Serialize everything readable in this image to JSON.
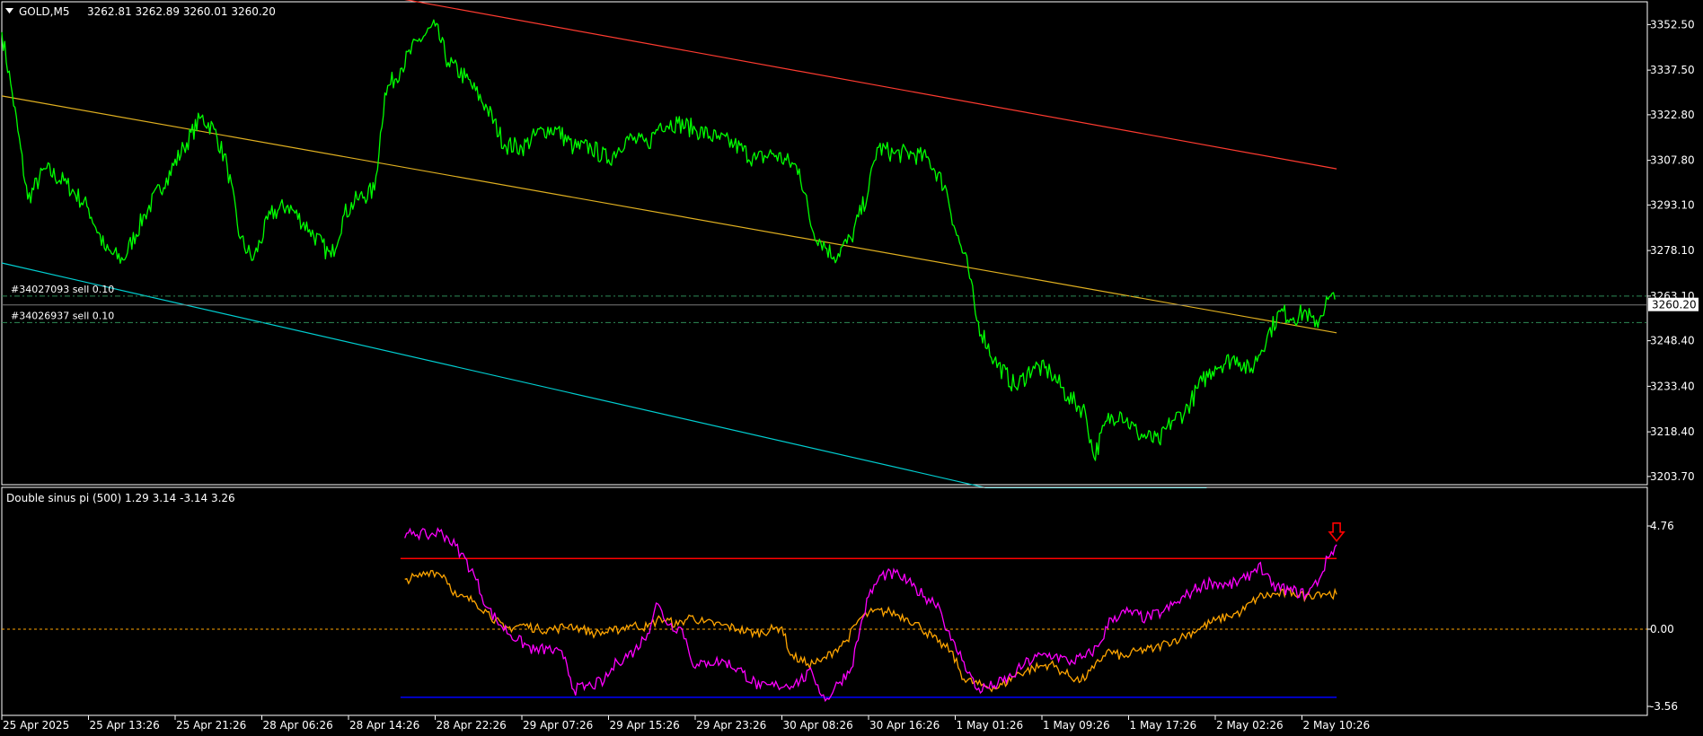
{
  "header": {
    "symbol_title": "GOLD,M5",
    "ohlc": "3262.81 3262.89 3260.01 3260.20"
  },
  "price_axis": {
    "ticks": [
      "3352.50",
      "3337.50",
      "3322.80",
      "3307.80",
      "3293.10",
      "3278.10",
      "3263.10",
      "3248.40",
      "3233.40",
      "3218.40",
      "3203.70"
    ],
    "current_price_label": "3260.20"
  },
  "orders": [
    {
      "label": "#34027093 sell 0.10",
      "price": 3263.1
    },
    {
      "label": "#34026937 sell 0.10",
      "price": 3254.4
    }
  ],
  "indicator": {
    "title": "Double sinus pi (500) 1.29 3.14 -3.14 3.26",
    "ticks": [
      "4.76",
      "0.00",
      "-3.56"
    ]
  },
  "time_axis": {
    "labels": [
      "25 Apr 2025",
      "25 Apr 13:26",
      "25 Apr 21:26",
      "28 Apr 06:26",
      "28 Apr 14:26",
      "28 Apr 22:26",
      "29 Apr 07:26",
      "29 Apr 15:26",
      "29 Apr 23:26",
      "30 Apr 08:26",
      "30 Apr 16:26",
      "1 May 01:26",
      "1 May 09:26",
      "1 May 17:26",
      "2 May 02:26",
      "2 May 10:26"
    ]
  },
  "colors": {
    "background": "#000000",
    "price_line": "#00ff00",
    "channel_upper": "#ff3b30",
    "channel_mid": "#e0b020",
    "channel_lower": "#00ced1",
    "order_line": "#2e8b57",
    "indicator_fast": "#ff00ff",
    "indicator_slow": "#ffa500",
    "indicator_upper_level": "#ff0000",
    "indicator_lower_level": "#0000ff",
    "zero_line": "#ffa500",
    "axis": "#ffffff",
    "signal_arrow": "#ff0000"
  },
  "chart_data": [
    {
      "type": "line",
      "title": "GOLD,M5",
      "ylim": [
        3201.0,
        3360.0
      ],
      "x": [
        "25 Apr 2025",
        "25 Apr 13:26",
        "25 Apr 21:26",
        "28 Apr 06:26",
        "28 Apr 14:26",
        "28 Apr 22:26",
        "29 Apr 07:26",
        "29 Apr 15:26",
        "29 Apr 23:26",
        "30 Apr 08:26",
        "30 Apr 16:26",
        "1 May 01:26",
        "1 May 09:26",
        "1 May 17:26",
        "2 May 02:26",
        "2 May 10:26"
      ],
      "series": [
        {
          "name": "GOLD,M5",
          "points": [
            [
              0,
              3350
            ],
            [
              0.12,
              3330
            ],
            [
              0.3,
              3295
            ],
            [
              0.5,
              3305
            ],
            [
              0.75,
              3300
            ],
            [
              1.0,
              3292
            ],
            [
              1.2,
              3278
            ],
            [
              1.4,
              3275
            ],
            [
              1.65,
              3290
            ],
            [
              1.9,
              3302
            ],
            [
              2.1,
              3312
            ],
            [
              2.3,
              3322
            ],
            [
              2.45,
              3318
            ],
            [
              2.6,
              3306
            ],
            [
              2.75,
              3282
            ],
            [
              2.9,
              3275
            ],
            [
              3.1,
              3290
            ],
            [
              3.3,
              3293
            ],
            [
              3.55,
              3285
            ],
            [
              3.8,
              3276
            ],
            [
              3.95,
              3290
            ],
            [
              4.1,
              3295
            ],
            [
              4.3,
              3298
            ],
            [
              4.42,
              3330
            ],
            [
              4.6,
              3338
            ],
            [
              4.8,
              3347
            ],
            [
              5.0,
              3352
            ],
            [
              5.15,
              3340
            ],
            [
              5.35,
              3335
            ],
            [
              5.6,
              3325
            ],
            [
              5.8,
              3313
            ],
            [
              6.0,
              3312
            ],
            [
              6.25,
              3318
            ],
            [
              6.4,
              3318
            ],
            [
              6.6,
              3312
            ],
            [
              6.8,
              3312
            ],
            [
              7.0,
              3308
            ],
            [
              7.2,
              3315
            ],
            [
              7.45,
              3313
            ],
            [
              7.6,
              3320
            ],
            [
              7.8,
              3320
            ],
            [
              8.0,
              3318
            ],
            [
              8.25,
              3315
            ],
            [
              8.45,
              3313
            ],
            [
              8.7,
              3308
            ],
            [
              8.9,
              3310
            ],
            [
              9.2,
              3305
            ],
            [
              9.35,
              3285
            ],
            [
              9.6,
              3276
            ],
            [
              9.8,
              3282
            ],
            [
              10.0,
              3298
            ],
            [
              10.1,
              3312
            ],
            [
              10.3,
              3310
            ],
            [
              10.5,
              3310
            ],
            [
              10.7,
              3308
            ],
            [
              10.9,
              3298
            ],
            [
              11.0,
              3285
            ],
            [
              11.15,
              3272
            ],
            [
              11.25,
              3255
            ],
            [
              11.45,
              3242
            ],
            [
              11.7,
              3233
            ],
            [
              11.9,
              3240
            ],
            [
              12.1,
              3238
            ],
            [
              12.3,
              3230
            ],
            [
              12.5,
              3225
            ],
            [
              12.6,
              3210
            ],
            [
              12.75,
              3222
            ],
            [
              12.9,
              3225
            ],
            [
              13.1,
              3218
            ],
            [
              13.35,
              3215
            ],
            [
              13.5,
              3222
            ],
            [
              13.65,
              3225
            ],
            [
              13.85,
              3235
            ],
            [
              14.0,
              3240
            ],
            [
              14.25,
              3243
            ],
            [
              14.4,
              3238
            ],
            [
              14.6,
              3250
            ],
            [
              14.75,
              3258
            ],
            [
              14.9,
              3256
            ],
            [
              15.05,
              3258
            ],
            [
              15.15,
              3253
            ],
            [
              15.3,
              3262
            ],
            [
              15.38,
              3262
            ]
          ]
        }
      ],
      "order_levels": [
        3263.1,
        3254.4
      ],
      "current_price": 3260.2,
      "trend_channel": {
        "upper": [
          [
            4.6,
            3361.0
          ],
          [
            15.4,
            3305.0
          ]
        ],
        "middle": [
          [
            0,
            3329.0
          ],
          [
            15.4,
            3251.0
          ]
        ],
        "lower": [
          [
            0,
            3274.0
          ],
          [
            11.35,
            3200.0
          ],
          [
            13.9,
            3200.0
          ]
        ]
      }
    },
    {
      "type": "line",
      "title": "Double sinus pi (500) 1.29 3.14 -3.14 3.26",
      "ylim": [
        -3.56,
        4.76
      ],
      "levels": {
        "upper": 3.26,
        "zero": 0.0,
        "lower": -3.14
      },
      "signal": {
        "type": "sell-arrow",
        "x": 15.4,
        "y": 3.9
      },
      "series": [
        {
          "name": "",
          "color": "fast",
          "points": [
            [
              4.65,
              4.2
            ],
            [
              4.75,
              4.5
            ],
            [
              4.9,
              4.3
            ],
            [
              5.05,
              4.5
            ],
            [
              5.15,
              4.2
            ],
            [
              5.3,
              3.5
            ],
            [
              5.45,
              2.5
            ],
            [
              5.6,
              1.0
            ],
            [
              5.75,
              0.2
            ],
            [
              5.95,
              -0.5
            ],
            [
              6.15,
              -1.0
            ],
            [
              6.3,
              -0.9
            ],
            [
              6.5,
              -1.3
            ],
            [
              6.6,
              -2.8
            ],
            [
              6.8,
              -2.6
            ],
            [
              6.95,
              -2.4
            ],
            [
              7.1,
              -1.5
            ],
            [
              7.3,
              -1.0
            ],
            [
              7.45,
              -0.2
            ],
            [
              7.55,
              1.2
            ],
            [
              7.7,
              0.2
            ],
            [
              7.85,
              0.0
            ],
            [
              8.0,
              -1.8
            ],
            [
              8.15,
              -1.5
            ],
            [
              8.35,
              -1.5
            ],
            [
              8.55,
              -2.0
            ],
            [
              8.75,
              -2.7
            ],
            [
              8.95,
              -2.6
            ],
            [
              9.15,
              -2.5
            ],
            [
              9.35,
              -2.0
            ],
            [
              9.5,
              -3.3
            ],
            [
              9.65,
              -2.5
            ],
            [
              9.8,
              -1.8
            ],
            [
              9.9,
              0.0
            ],
            [
              10.0,
              1.5
            ],
            [
              10.15,
              2.5
            ],
            [
              10.35,
              2.5
            ],
            [
              10.5,
              2.0
            ],
            [
              10.65,
              1.5
            ],
            [
              10.8,
              1.2
            ],
            [
              10.95,
              -0.5
            ],
            [
              11.1,
              -1.5
            ],
            [
              11.25,
              -2.8
            ],
            [
              11.45,
              -2.6
            ],
            [
              11.65,
              -2.2
            ],
            [
              11.8,
              -1.6
            ],
            [
              12.0,
              -1.2
            ],
            [
              12.15,
              -1.2
            ],
            [
              12.3,
              -1.5
            ],
            [
              12.5,
              -1.3
            ],
            [
              12.65,
              -0.8
            ],
            [
              12.8,
              0.5
            ],
            [
              13.0,
              0.8
            ],
            [
              13.2,
              0.5
            ],
            [
              13.4,
              0.8
            ],
            [
              13.55,
              1.2
            ],
            [
              13.75,
              1.8
            ],
            [
              13.95,
              2.2
            ],
            [
              14.15,
              2.0
            ],
            [
              14.35,
              2.3
            ],
            [
              14.5,
              3.0
            ],
            [
              14.65,
              2.0
            ],
            [
              14.85,
              1.8
            ],
            [
              15.05,
              1.6
            ],
            [
              15.2,
              2.3
            ],
            [
              15.3,
              3.3
            ],
            [
              15.4,
              3.9
            ]
          ]
        },
        {
          "name": "",
          "color": "slow",
          "points": [
            [
              4.65,
              2.3
            ],
            [
              4.8,
              2.4
            ],
            [
              4.95,
              2.7
            ],
            [
              5.1,
              2.5
            ],
            [
              5.25,
              1.5
            ],
            [
              5.45,
              1.3
            ],
            [
              5.6,
              0.8
            ],
            [
              5.8,
              0.0
            ],
            [
              6.0,
              0.2
            ],
            [
              6.2,
              0.0
            ],
            [
              6.4,
              0.0
            ],
            [
              6.55,
              0.2
            ],
            [
              6.7,
              0.0
            ],
            [
              6.85,
              -0.2
            ],
            [
              7.05,
              -0.1
            ],
            [
              7.25,
              0.2
            ],
            [
              7.45,
              0.1
            ],
            [
              7.6,
              0.5
            ],
            [
              7.8,
              0.2
            ],
            [
              7.95,
              0.6
            ],
            [
              8.1,
              0.3
            ],
            [
              8.3,
              0.2
            ],
            [
              8.5,
              0.0
            ],
            [
              8.7,
              -0.2
            ],
            [
              8.9,
              0.0
            ],
            [
              9.0,
              0.1
            ],
            [
              9.1,
              -1.2
            ],
            [
              9.3,
              -1.6
            ],
            [
              9.45,
              -1.5
            ],
            [
              9.6,
              -1.0
            ],
            [
              9.75,
              -0.5
            ],
            [
              9.9,
              0.5
            ],
            [
              10.05,
              0.8
            ],
            [
              10.25,
              0.8
            ],
            [
              10.45,
              0.5
            ],
            [
              10.6,
              0.1
            ],
            [
              10.8,
              -0.6
            ],
            [
              10.95,
              -1.0
            ],
            [
              11.1,
              -2.3
            ],
            [
              11.3,
              -2.6
            ],
            [
              11.5,
              -2.7
            ],
            [
              11.7,
              -2.1
            ],
            [
              11.9,
              -1.8
            ],
            [
              12.1,
              -1.6
            ],
            [
              12.25,
              -2.0
            ],
            [
              12.45,
              -2.4
            ],
            [
              12.6,
              -1.8
            ],
            [
              12.75,
              -1.0
            ],
            [
              12.95,
              -1.3
            ],
            [
              13.1,
              -1.0
            ],
            [
              13.3,
              -0.9
            ],
            [
              13.45,
              -0.6
            ],
            [
              13.6,
              -0.4
            ],
            [
              13.8,
              0.0
            ],
            [
              14.0,
              0.4
            ],
            [
              14.15,
              0.6
            ],
            [
              14.3,
              0.8
            ],
            [
              14.5,
              1.5
            ],
            [
              14.7,
              1.6
            ],
            [
              14.9,
              1.7
            ],
            [
              15.05,
              1.5
            ],
            [
              15.2,
              1.7
            ],
            [
              15.4,
              1.6
            ]
          ]
        }
      ]
    }
  ]
}
